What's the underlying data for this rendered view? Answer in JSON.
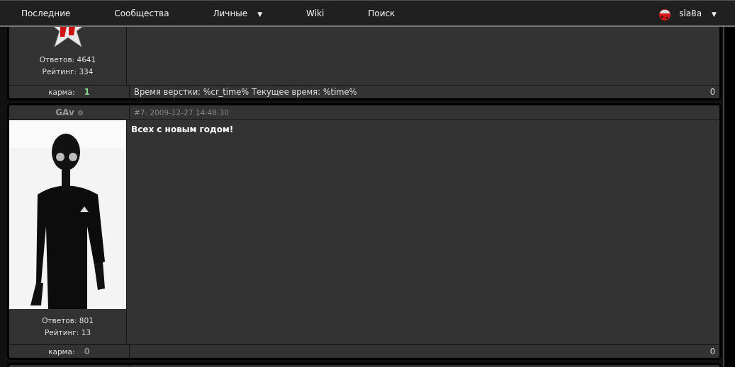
{
  "nav": {
    "items": [
      {
        "label": "Последние"
      },
      {
        "label": "Сообщества"
      },
      {
        "label": "Личные",
        "caret": "▼"
      },
      {
        "label": "Wiki"
      },
      {
        "label": "Поиск"
      }
    ],
    "user": {
      "name": "sla8a",
      "caret": "▼"
    }
  },
  "posts": [
    {
      "avatar": {
        "kind": "icon"
      },
      "stats": [
        "Ответов: 4641",
        "Рейтинг: 334"
      ],
      "karma_label": "карма:",
      "karma": {
        "value": "1",
        "color": "#88dd88"
      },
      "signature": "Время верстки: %cr_time% Текущее время: %time%",
      "count": "0"
    },
    {
      "author": "GAv",
      "online": false,
      "meta": "#7: 2009-12-27 14:48:30",
      "body": "Всех с новым годом!",
      "stats": [
        "Ответов: 801",
        "Рейтинг: 13"
      ],
      "karma_label": "карма:",
      "karma": {
        "value": "0",
        "color": "#888888"
      },
      "count": "0"
    }
  ]
}
